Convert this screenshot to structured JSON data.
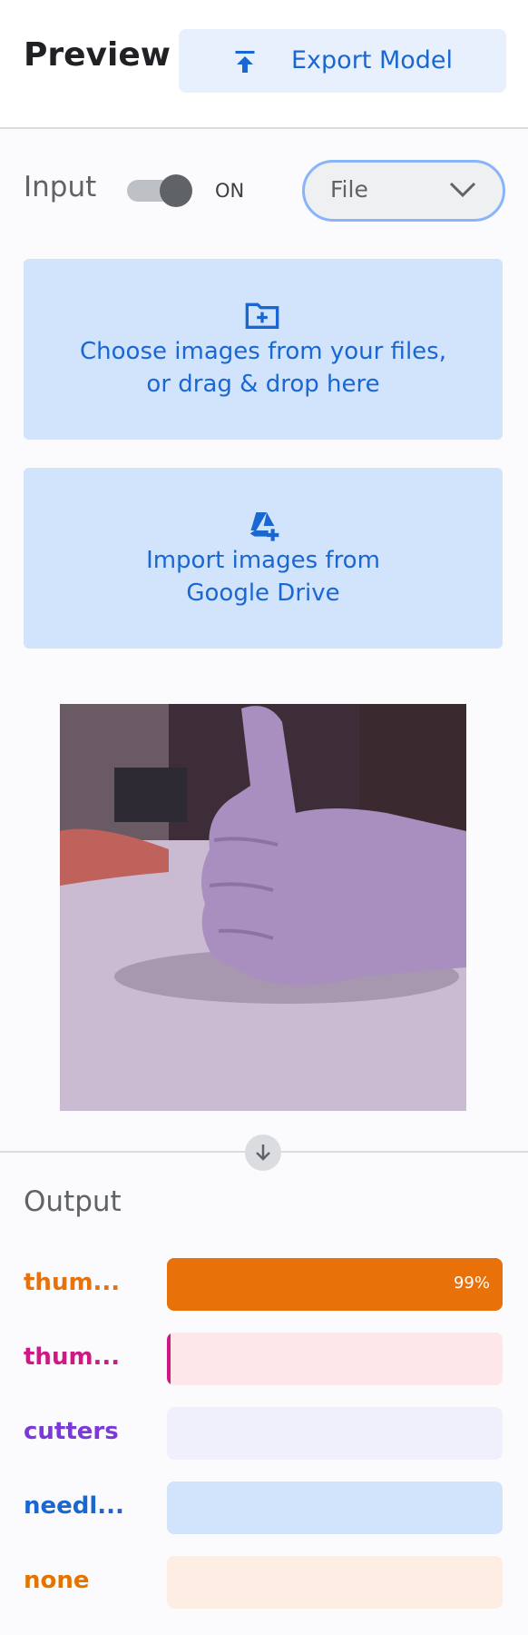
{
  "header": {
    "title": "Preview",
    "export_label": "Export Model",
    "export_icon": "upload-arrow-icon"
  },
  "input": {
    "label": "Input",
    "toggle_state": "ON",
    "toggle_on": true,
    "source_select": "File"
  },
  "upload_files": {
    "icon": "folder-add-icon",
    "line1": "Choose images from your files,",
    "line2": "or drag & drop here"
  },
  "import_drive": {
    "icon": "google-drive-add-icon",
    "line1": "Import images from",
    "line2": "Google Drive"
  },
  "output": {
    "title": "Output",
    "classes": [
      {
        "label": "thum...",
        "value": 0.99,
        "percent_text": "99%",
        "color": "#e8710a",
        "track": "#e8710a"
      },
      {
        "label": "thum...",
        "value": 0.01,
        "percent_text": "",
        "color": "#d01884",
        "track": "#fde7e9"
      },
      {
        "label": "cutters",
        "value": 0.0,
        "percent_text": "",
        "color": "#7b39d9",
        "track": "#f0f0fc"
      },
      {
        "label": "needl...",
        "value": 0.0,
        "percent_text": "",
        "color": "#1967d2",
        "track": "#d2e3fc"
      },
      {
        "label": "none",
        "value": 0.0,
        "percent_text": "",
        "color": "#e37400",
        "track": "#feede3"
      }
    ]
  },
  "colors": {
    "accent": "#1967d2",
    "card_bg": "#d2e3fc",
    "top_class_bar": "#e8710a"
  }
}
